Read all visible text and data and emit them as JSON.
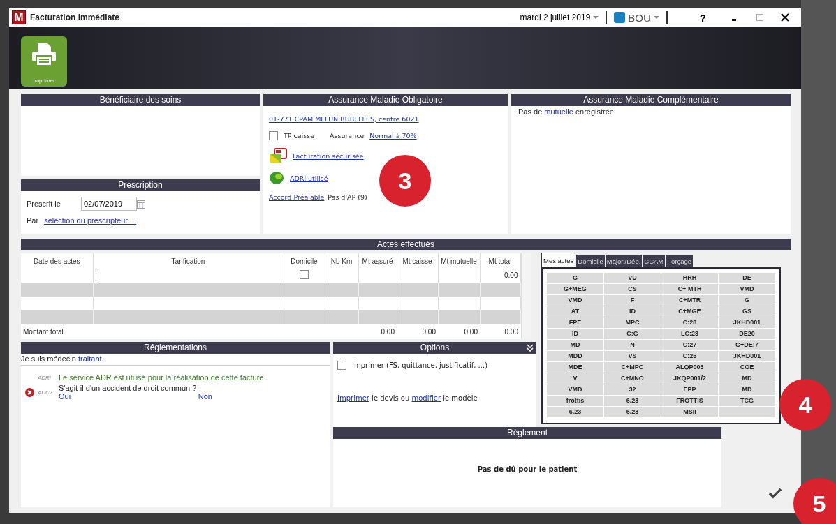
{
  "window": {
    "logo": "M",
    "title": "Facturation immédiate",
    "date": "mardi 2 juillet 2019",
    "user": "BOU",
    "help": "?"
  },
  "toolbar": [
    {
      "label": "Imprimer"
    }
  ],
  "beneficiaire": {
    "title": "Bénéficiaire des soins"
  },
  "prescription": {
    "title": "Prescription",
    "date_label": "Prescrit le",
    "date_value": "02/07/2019",
    "par_label": "Par",
    "prescriber_link": "sélection du prescripteur ..."
  },
  "amo": {
    "title": "Assurance Maladie Obligatoire",
    "caisse_link": "01-771 CPAM MELUN RUBELLES, centre 6021",
    "tp_caisse": {
      "label": "TP caisse",
      "checked": false
    },
    "assurance_label": "Assurance",
    "assurance_link": "Normal à 70%",
    "secure_link": "Facturation sécurisée",
    "adri_link": "ADRi utilisé",
    "ap_link": "Accord Préalable",
    "ap_text": "Pas d'AP (9)"
  },
  "amc": {
    "title": "Assurance Maladie Complémentaire",
    "text_before": "Pas de",
    "link": "mutuelle",
    "text_after": "enregistrée"
  },
  "actes": {
    "title": "Actes effectués",
    "columns": [
      "Date des actes",
      "Tarification",
      "Domicile",
      "Nb Km",
      "Mt assuré",
      "Mt caisse",
      "Mt mutuelle",
      "Mt total"
    ],
    "rows": [
      {
        "shaded": false,
        "editing": true,
        "domicile": {
          "checked": false
        },
        "mt_total": "0.00"
      },
      {
        "shaded": true,
        "editing": false
      },
      {
        "shaded": false,
        "editing": false
      },
      {
        "shaded": true,
        "editing": false
      }
    ],
    "footer": {
      "label": "Montant total",
      "mt_assure": "0.00",
      "mt_caisse": "0.00",
      "mt_mutuelle": "0.00",
      "mt_total": "0.00"
    }
  },
  "acts_tabs": [
    {
      "label": "Mes actes",
      "selected": true
    },
    {
      "label": "Domicile",
      "selected": false
    },
    {
      "label": "Major./Dép.",
      "selected": false
    },
    {
      "label": "CCAM",
      "selected": false
    },
    {
      "label": "Forçage",
      "selected": false
    }
  ],
  "acts_grid": [
    [
      "G",
      "VU",
      "HRH",
      "DE"
    ],
    [
      "G+MEG",
      "CS",
      "C+ MTH",
      "VMD"
    ],
    [
      "VMD",
      "F",
      "C+MTR",
      "G"
    ],
    [
      "AT",
      "ID",
      "C+MGE",
      "GS"
    ],
    [
      "FPE",
      "MPC",
      "C:28",
      "JKHD001"
    ],
    [
      "ID",
      "C:G",
      "LC:28",
      "DE20"
    ],
    [
      "MD",
      "N",
      "C:27",
      "G+DE:7"
    ],
    [
      "MDD",
      "VS",
      "C:25",
      "JKHD001"
    ],
    [
      "MDE",
      "C+MPC",
      "ALQP003",
      "COE"
    ],
    [
      "V",
      "C+MNO",
      "JKQP001/2",
      "MD"
    ],
    [
      "VMD",
      "32",
      "EPP",
      "MD"
    ],
    [
      "frottis",
      "6.23",
      "FROTTIS",
      "TCG"
    ],
    [
      "6.23",
      "6.23",
      "MSII"
    ]
  ],
  "reglementations": {
    "title": "Réglementations",
    "medecin_before": "Je suis médecin",
    "medecin_link": "traitant",
    "medecin_after": ".",
    "messages": [
      {
        "kind": "info",
        "code": "ADRi",
        "text": "Le service ADR est utilisé pour la réalisation de cette facture"
      },
      {
        "kind": "error",
        "code": "ADC7",
        "text": "S'agit-il d'un accident de droit commun ?",
        "answers": [
          "Oui",
          "Non"
        ]
      }
    ]
  },
  "options": {
    "title": "Options",
    "print_option": {
      "label": "Imprimer (FS, quittance, justificatif, ...)",
      "checked": false
    },
    "devis_link": "Imprimer",
    "devis_middle": "le devis ou",
    "modify_link": "modifier",
    "devis_end": "le modèle"
  },
  "reglement": {
    "title": "Règlement",
    "message": "Pas de dû pour le patient"
  },
  "callouts": [
    "3",
    "4",
    "5"
  ]
}
